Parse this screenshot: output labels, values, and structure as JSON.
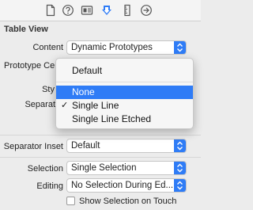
{
  "toolbar": {
    "icons": [
      "file-icon",
      "help-icon",
      "identity-icon",
      "attributes-icon",
      "size-icon",
      "connections-icon"
    ],
    "accent": "#2f7cf6"
  },
  "section_title": "Table View",
  "rows": {
    "content": {
      "label": "Content",
      "value": "Dynamic Prototypes"
    },
    "prototype_cells": {
      "label": "Prototype Cel"
    },
    "style": {
      "label": "Sty"
    },
    "separator": {
      "label": "Separat"
    },
    "separator_inset": {
      "label": "Separator Inset",
      "value": "Default"
    },
    "selection": {
      "label": "Selection",
      "value": "Single Selection"
    },
    "editing": {
      "label": "Editing",
      "value": "No Selection During Ed..."
    },
    "show_selection": {
      "label": "Show Selection on Touch",
      "checked": false
    }
  },
  "menu": {
    "items": [
      {
        "label": "Default",
        "highlighted": false,
        "checked": false
      },
      {
        "label": "None",
        "highlighted": true,
        "checked": false
      },
      {
        "label": "Single Line",
        "highlighted": false,
        "checked": true
      },
      {
        "label": "Single Line Etched",
        "highlighted": false,
        "checked": false
      }
    ],
    "check_glyph": "✓"
  }
}
